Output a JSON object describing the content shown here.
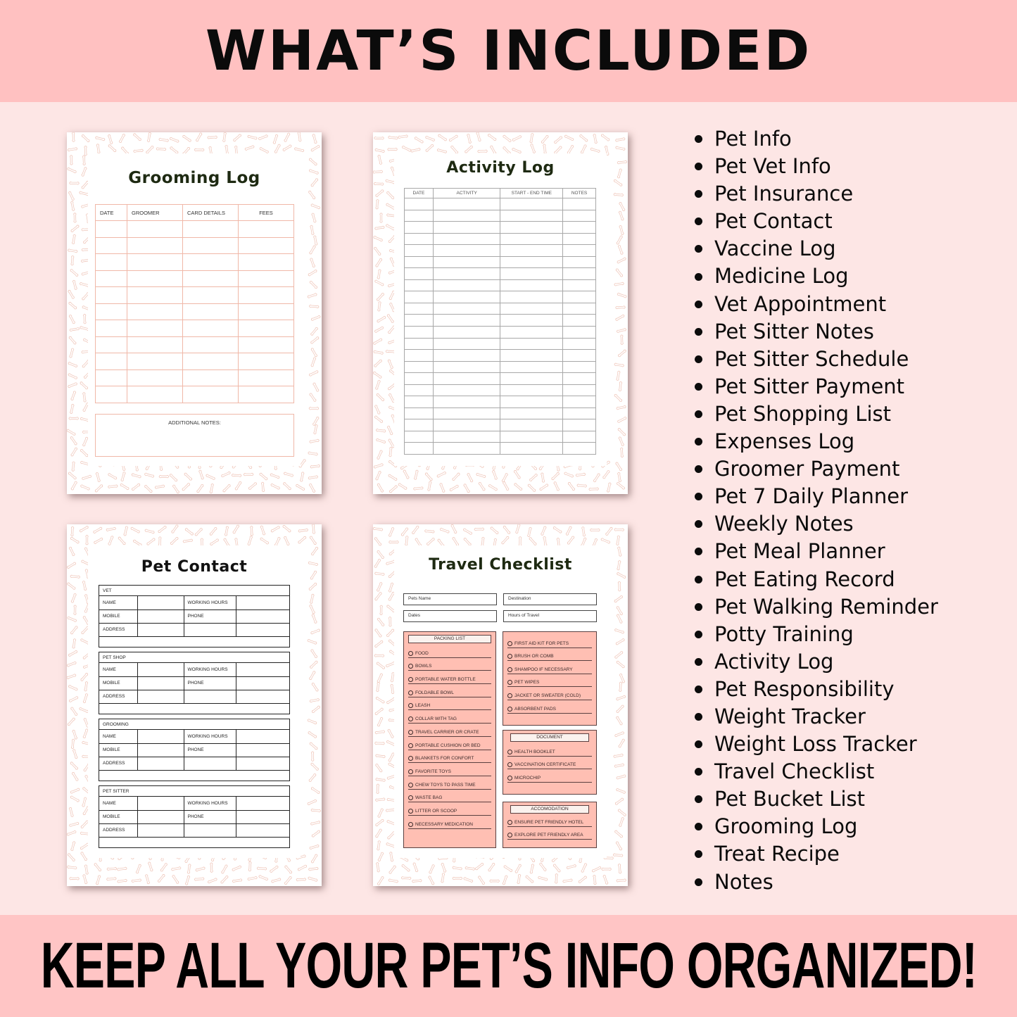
{
  "header": {
    "title": "WHAT’S INCLUDED"
  },
  "footer": {
    "tagline": "KEEP ALL YOUR PET’S INFO ORGANIZED!"
  },
  "colors": {
    "banner": "#ffc1c1",
    "background": "#fde6e5",
    "grooming_line": "#f0b8a8",
    "travel_box": "#ffbfb3",
    "title_text": "#1e2a12"
  },
  "pages": {
    "grooming": {
      "title": "Grooming Log",
      "columns": [
        "DATE",
        "GROOMER",
        "CARD DETAILS",
        "FEES"
      ],
      "notes_label": "ADDITIONAL NOTES:"
    },
    "activity": {
      "title": "Activity Log",
      "columns": [
        "DATE",
        "ACTIVITY",
        "START - END TIME",
        "NOTES"
      ]
    },
    "contact": {
      "title": "Pet Contact",
      "sections": [
        "VET",
        "PET SHOP",
        "GROOMING",
        "PET SITTER"
      ],
      "labels": {
        "name": "NAME",
        "mobile": "MOBILE",
        "address": "ADDRESS",
        "working_hours": "WORKING HOURS",
        "phone": "PHONE"
      }
    },
    "travel": {
      "title": "Travel Checklist",
      "fields": {
        "pets_name": "Pets Name",
        "destination": "Destination",
        "dates": "Dates",
        "hours": "Hours of Travel"
      },
      "packing_header": "PACKING LIST",
      "packing": [
        "FOOD",
        "BOWLS",
        "PORTABLE WATER BOTTLE",
        "FOLDABLE BOWL",
        "LEASH",
        "COLLAR WITH TAG",
        "TRAVEL CARRIER OR CRATE",
        "PORTABLE CUSHION OR BED",
        "BLANKETS FOR CONFORT",
        "FAVORITE TOYS",
        "CHEW TOYS TO PASS TIME",
        "WASTE BAG",
        "LITTER OR SCOOP",
        "NECESSARY MEDICATION"
      ],
      "extras": [
        "FIRST AID KIT FOR PETS",
        "BRUSH OR COMB",
        "SHAMPOO IF NECESSARY",
        "PET WIPES",
        "JACKET OR SWEATER (COLD)",
        "ABSORBENT PADS"
      ],
      "document_header": "DOCUMENT",
      "documents": [
        "HEALTH BOOKLET",
        "VACCINATION CERTIFICATE",
        "MICROCHIP"
      ],
      "accommodation_header": "ACCOMODATION",
      "accommodation": [
        "ENSURE PET FRIENDLY HOTEL",
        "EXPLORE PET FRIENDLY AREA"
      ]
    }
  },
  "included": [
    "Pet Info",
    "Pet Vet Info",
    "Pet Insurance",
    "Pet Contact",
    "Vaccine Log",
    "Medicine Log",
    "Vet Appointment",
    "Pet Sitter Notes",
    "Pet Sitter Schedule",
    "Pet Sitter Payment",
    "Pet Shopping List",
    "Expenses Log",
    "Groomer Payment",
    "Pet 7 Daily Planner",
    "Weekly Notes",
    "Pet Meal Planner",
    "Pet Eating Record",
    "Pet Walking Reminder",
    "Potty Training",
    "Activity Log",
    "Pet Responsibility",
    "Weight Tracker",
    "Weight Loss Tracker",
    "Travel Checklist",
    "Pet Bucket List",
    "Grooming Log",
    "Treat Recipe",
    "Notes"
  ]
}
